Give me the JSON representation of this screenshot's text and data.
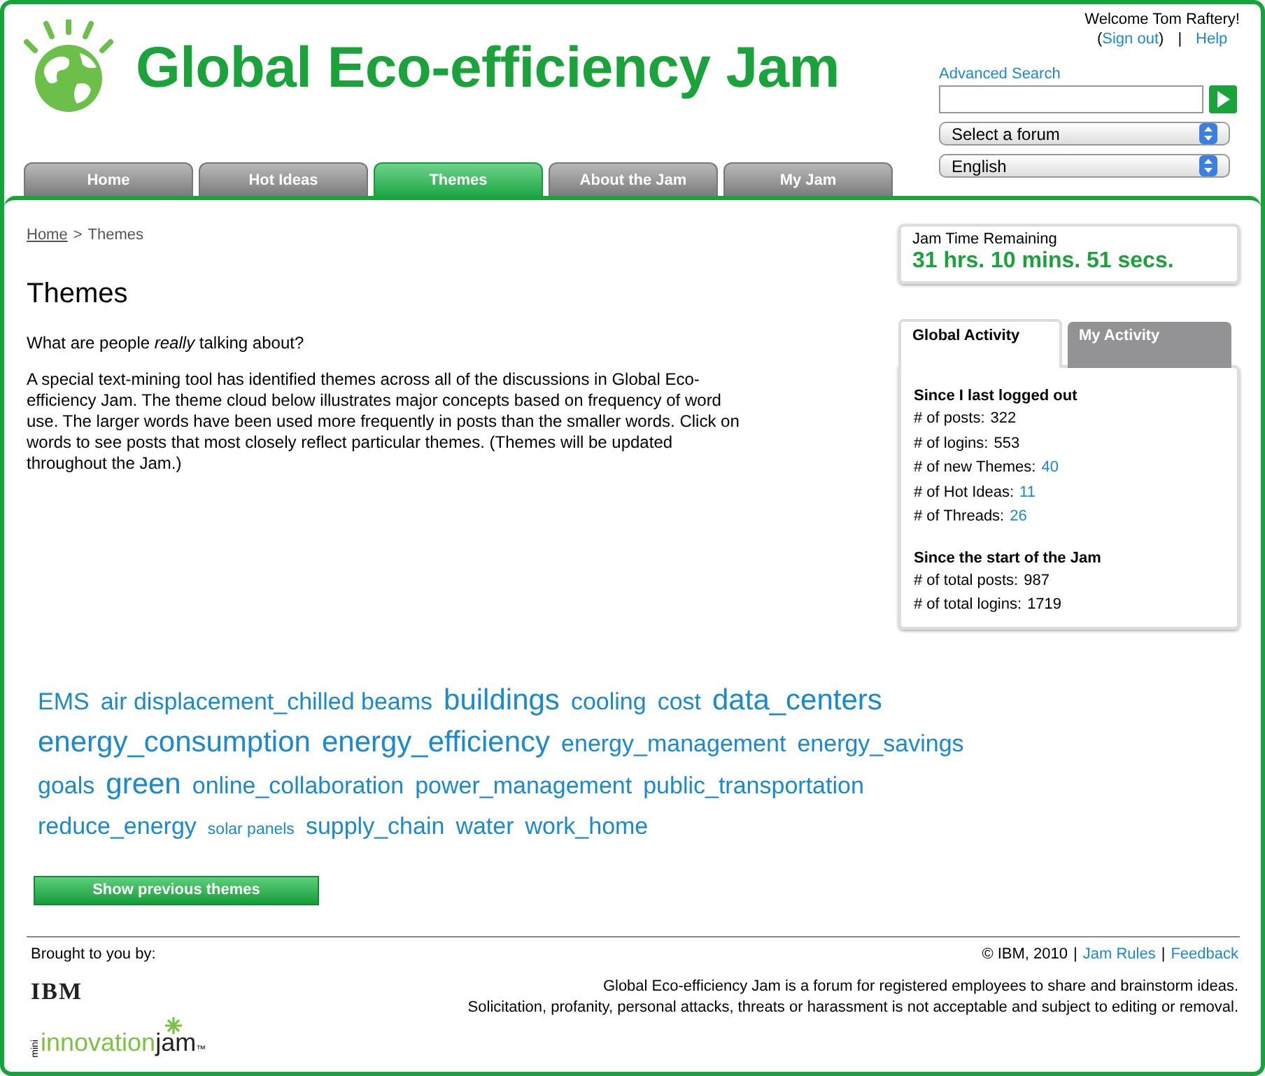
{
  "header": {
    "title": "Global Eco-efficiency Jam",
    "welcome": "Welcome Tom Raftery!",
    "user_links": [
      {
        "text": "(",
        "kind": "text"
      },
      {
        "text": "Sign out",
        "kind": "link"
      },
      {
        "text": ")",
        "kind": "text"
      },
      {
        "text": "|",
        "kind": "sep"
      },
      {
        "text": "Help",
        "kind": "link"
      }
    ],
    "advanced_search": "Advanced Search",
    "forum_select": "Select a forum",
    "language_select": "English"
  },
  "tabs": [
    {
      "label": "Home",
      "selected": false
    },
    {
      "label": "Hot Ideas",
      "selected": false
    },
    {
      "label": "Themes",
      "selected": true
    },
    {
      "label": "About the Jam",
      "selected": false
    },
    {
      "label": "My Jam",
      "selected": false
    }
  ],
  "breadcrumb": {
    "home": "Home",
    "separator": ">",
    "current": "Themes"
  },
  "heading": "Themes",
  "intro": "What are people *really* talking about?",
  "description": "A special text-mining tool has identified themes across all of the discussions in Global Eco-efficiency Jam. The theme cloud below illustrates major concepts based on frequency of word use. The larger words have been used more frequently in posts than the smaller words. Click on words to see posts that most closely reflect particular themes. (Themes will be updated throughout the Jam.)",
  "timer": {
    "label": "Jam Time Remaining",
    "value": "31 hrs. 10 mins. 51 secs."
  },
  "activity": {
    "tabs": [
      {
        "label": "Global Activity",
        "selected": true
      },
      {
        "label": "My Activity",
        "selected": false
      }
    ],
    "sections": [
      {
        "heading": "Since I last logged out",
        "rows": [
          {
            "label": "# of posts:",
            "value": "322",
            "link": false
          },
          {
            "label": "# of logins:",
            "value": "553",
            "link": false
          },
          {
            "label": "# of new Themes:",
            "value": "40",
            "link": true
          },
          {
            "label": "# of Hot Ideas:",
            "value": "11",
            "link": true
          },
          {
            "label": "# of Threads:",
            "value": "26",
            "link": true
          }
        ]
      },
      {
        "heading": "Since the start of the Jam",
        "rows": [
          {
            "label": "# of total posts:",
            "value": "987",
            "link": false
          },
          {
            "label": "# of total logins:",
            "value": "1719",
            "link": false
          }
        ]
      }
    ]
  },
  "theme_cloud": [
    {
      "text": "EMS",
      "kind": "medium"
    },
    {
      "text": "air displacement_chilled beams",
      "kind": "medium"
    },
    {
      "text": "buildings",
      "kind": "large"
    },
    {
      "text": "cooling",
      "kind": "medium"
    },
    {
      "text": "cost",
      "kind": "medium"
    },
    {
      "text": "data_centers",
      "kind": "large"
    },
    {
      "text": "energy_consumption",
      "kind": "large"
    },
    {
      "text": "energy_efficiency",
      "kind": "large"
    },
    {
      "text": "energy_management",
      "kind": "medium"
    },
    {
      "text": "energy_savings",
      "kind": "medium"
    },
    {
      "text": "goals",
      "kind": "medium"
    },
    {
      "text": "green",
      "kind": "large"
    },
    {
      "text": "online_collaboration",
      "kind": "medium"
    },
    {
      "text": "power_management",
      "kind": "medium"
    },
    {
      "text": "public_transportation",
      "kind": "medium"
    },
    {
      "text": "reduce_energy",
      "kind": "medium"
    },
    {
      "text": "solar panels",
      "kind": "small"
    },
    {
      "text": "supply_chain",
      "kind": "medium"
    },
    {
      "text": "water",
      "kind": "medium"
    },
    {
      "text": "work_home",
      "kind": "medium"
    }
  ],
  "previous_button": "Show previous themes",
  "footer": {
    "brought_by": "Brought to you by:",
    "links": [
      {
        "text": "© IBM, 2010",
        "kind": "text"
      },
      {
        "text": "|",
        "kind": "sep"
      },
      {
        "text": "Jam Rules",
        "kind": "link"
      },
      {
        "text": "|",
        "kind": "sep"
      },
      {
        "text": "Feedback",
        "kind": "link"
      }
    ],
    "ibm_logo": "IBM",
    "innovation_logo": {
      "prefix": "mini",
      "main": "innovation",
      "suffix": "jam",
      "mark": "™"
    },
    "notice": [
      "Global Eco-efficiency Jam is a forum for registered employees to share and brainstorm ideas.",
      "Solicitation, profanity, personal attacks, threats or harassment is not acceptable and subject to editing or removal."
    ]
  }
}
